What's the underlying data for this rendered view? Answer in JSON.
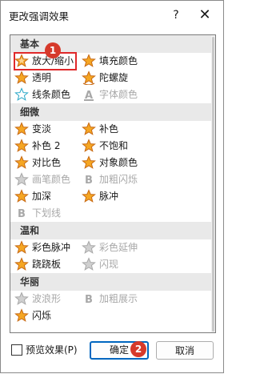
{
  "window": {
    "title": "更改强调效果",
    "help": "?",
    "close": "✕"
  },
  "groups": [
    {
      "name": "基本",
      "rows": [
        [
          {
            "label": "放大/缩小",
            "icon": "zoom-star-icon",
            "disabled": false,
            "selected": true
          },
          {
            "label": "填充颜色",
            "icon": "fill-color-star-icon",
            "disabled": false
          }
        ],
        [
          {
            "label": "透明",
            "icon": "transparency-star-icon",
            "disabled": false
          },
          {
            "label": "陀螺旋",
            "icon": "spin-star-icon",
            "disabled": false
          }
        ],
        [
          {
            "label": "线条颜色",
            "icon": "line-color-star-icon",
            "disabled": false
          },
          {
            "label": "字体颜色",
            "icon": "font-color-icon",
            "disabled": true
          }
        ]
      ]
    },
    {
      "name": "细微",
      "rows": [
        [
          {
            "label": "变淡",
            "icon": "desaturate-star-icon",
            "disabled": false
          },
          {
            "label": "补色",
            "icon": "complement-star-icon",
            "disabled": false
          }
        ],
        [
          {
            "label": "补色 2",
            "icon": "complement2-star-icon",
            "disabled": false
          },
          {
            "label": "不饱和",
            "icon": "unsaturate-star-icon",
            "disabled": false
          }
        ],
        [
          {
            "label": "对比色",
            "icon": "contrast-star-icon",
            "disabled": false
          },
          {
            "label": "对象颜色",
            "icon": "object-color-star-icon",
            "disabled": false
          }
        ],
        [
          {
            "label": "画笔颜色",
            "icon": "brush-color-star-icon",
            "disabled": true
          },
          {
            "label": "加粗闪烁",
            "icon": "bold-flash-icon",
            "disabled": true
          }
        ],
        [
          {
            "label": "加深",
            "icon": "darken-star-icon",
            "disabled": false
          },
          {
            "label": "脉冲",
            "icon": "pulse-star-icon",
            "disabled": false
          }
        ],
        [
          {
            "label": "下划线",
            "icon": "underline-icon",
            "disabled": true
          }
        ]
      ]
    },
    {
      "name": "温和",
      "rows": [
        [
          {
            "label": "彩色脉冲",
            "icon": "color-pulse-star-icon",
            "disabled": false
          },
          {
            "label": "彩色延伸",
            "icon": "color-wave-star-icon",
            "disabled": true
          }
        ],
        [
          {
            "label": "跷跷板",
            "icon": "teeter-star-icon",
            "disabled": false
          },
          {
            "label": "闪现",
            "icon": "flicker-star-icon",
            "disabled": true
          }
        ]
      ]
    },
    {
      "name": "华丽",
      "rows": [
        [
          {
            "label": "波浪形",
            "icon": "wave-star-icon",
            "disabled": true
          },
          {
            "label": "加粗展示",
            "icon": "bold-reveal-icon",
            "disabled": true
          }
        ],
        [
          {
            "label": "闪烁",
            "icon": "blink-star-icon",
            "disabled": false
          }
        ]
      ]
    }
  ],
  "badges": {
    "first": "1",
    "second": "2"
  },
  "footer": {
    "preview_label": "预览效果(P)",
    "preview_checked": false,
    "ok_label": "确定",
    "cancel_label": "取消"
  },
  "colors": {
    "accent": "#0067c0",
    "highlight": "#e0282a",
    "star_orange": "#f5a623",
    "star_teal": "#2aa8c8",
    "star_dark": "#c86a14"
  }
}
